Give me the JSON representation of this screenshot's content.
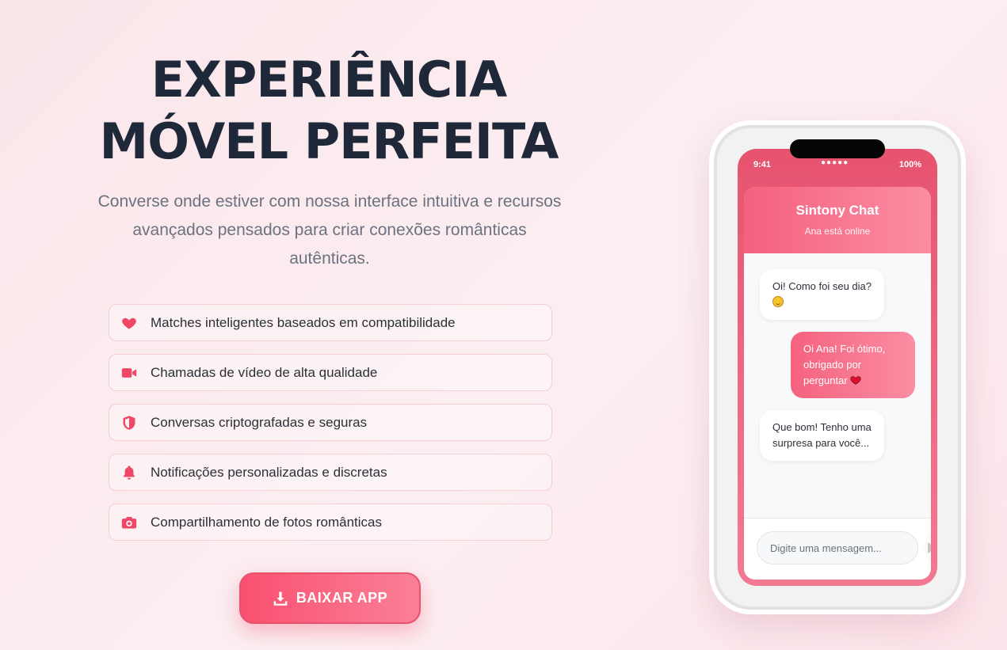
{
  "hero": {
    "title_line1": "EXPERIÊNCIA",
    "title_line2": "MÓVEL PERFEITA",
    "subtitle": "Converse onde estiver com nossa interface intuitiva e recursos avançados pensados para criar conexões românticas autênticas."
  },
  "features": [
    {
      "icon": "heart-icon",
      "label": "Matches inteligentes baseados em compatibilidade"
    },
    {
      "icon": "video-camera-icon",
      "label": "Chamadas de vídeo de alta qualidade"
    },
    {
      "icon": "shield-icon",
      "label": "Conversas criptografadas e seguras"
    },
    {
      "icon": "bell-icon",
      "label": "Notificações personalizadas e discretas"
    },
    {
      "icon": "camera-icon",
      "label": "Compartilhamento de fotos românticas"
    }
  ],
  "download": {
    "label": "BAIXAR APP",
    "icon": "download-icon"
  },
  "phone": {
    "status": {
      "time": "9:41",
      "signal": "●●●●●",
      "battery": "100%"
    },
    "header": {
      "title": "Sintony Chat",
      "status": "Ana está online"
    },
    "messages": [
      {
        "side": "in",
        "text": "Oi! Como foi seu dia?",
        "emoji": "smile-emoji"
      },
      {
        "side": "out",
        "text": "Oi Ana! Foi ótimo, obrigado por perguntar",
        "emoji": "heart-emoji"
      },
      {
        "side": "in",
        "text": "Que bom! Tenho uma surpresa para você..."
      }
    ],
    "input_placeholder": "Digite uma mensagem..."
  },
  "colors": {
    "accent": "#ef4867",
    "title": "#1e2838",
    "subtitle": "#6b7280",
    "background": "#fbe8ec"
  }
}
